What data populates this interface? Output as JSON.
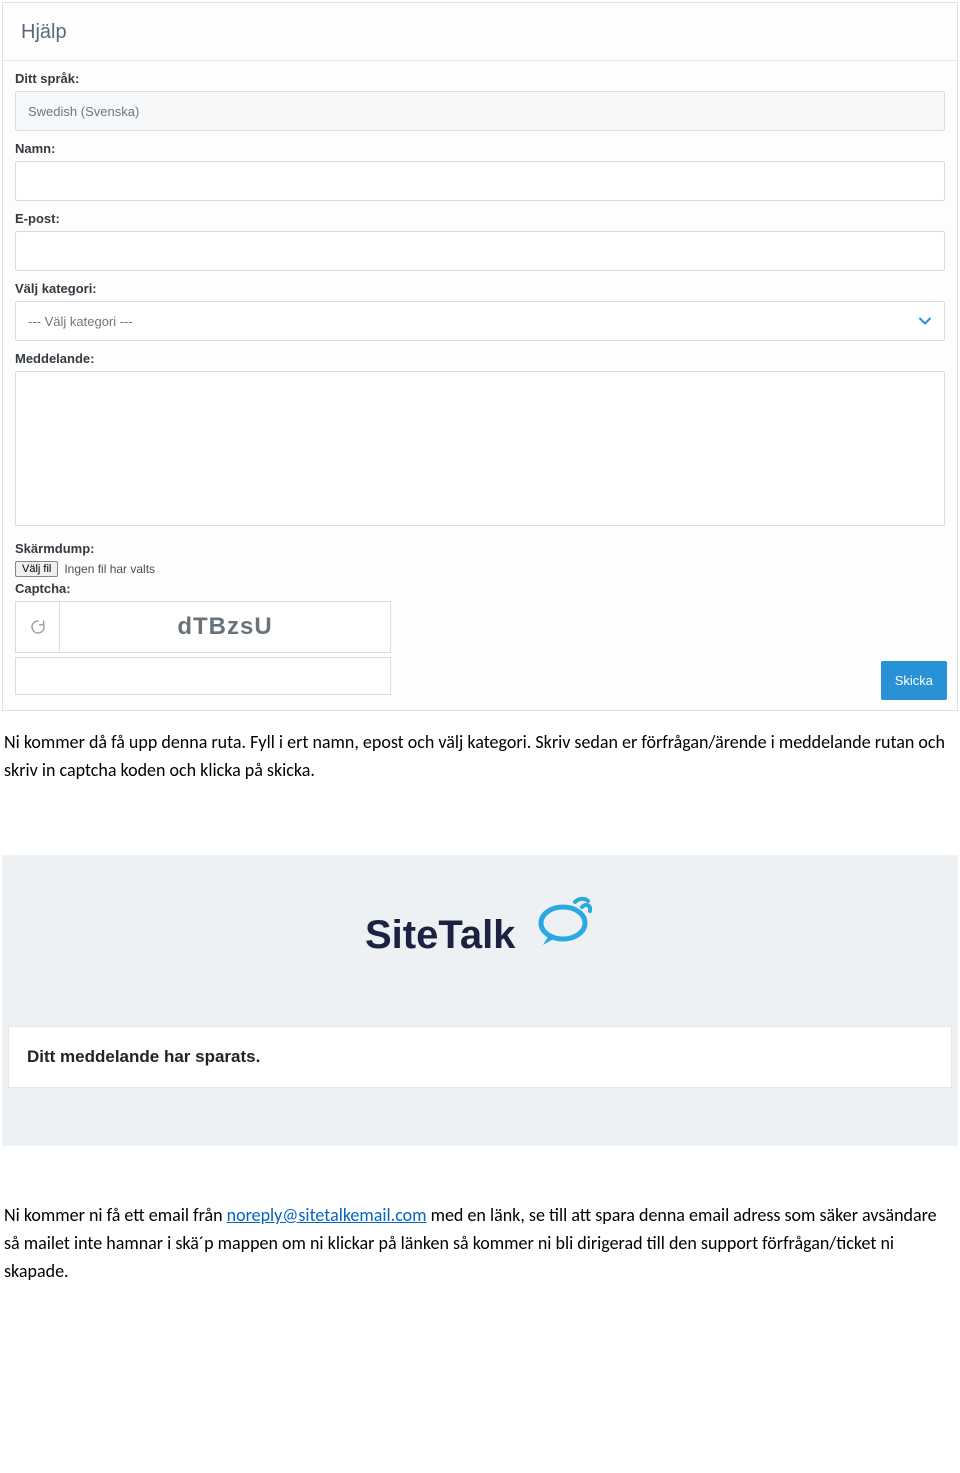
{
  "form": {
    "title": "Hjälp",
    "language_label": "Ditt språk:",
    "language_value": "Swedish (Svenska)",
    "name_label": "Namn:",
    "name_value": "",
    "email_label": "E-post:",
    "email_value": "",
    "category_label": "Välj kategori:",
    "category_value": "--- Välj kategori ---",
    "message_label": "Meddelande:",
    "message_value": "",
    "screenshot_label": "Skärmdump:",
    "file_button": "Välj fil",
    "file_status": "Ingen fil har valts",
    "captcha_label": "Captcha:",
    "captcha_value": "dTBzsU",
    "submit_label": "Skicka"
  },
  "instruction1": "Ni kommer då få upp denna ruta. Fyll i ert namn, epost och välj kategori. Skriv sedan er förfrågan/ärende i meddelande rutan och skriv in captcha koden och klicka på skicka.",
  "saved_message": "Ditt meddelande har sparats.",
  "instruction2_part1": "Ni kommer ni få ett email från ",
  "instruction2_link": "noreply@sitetalkemail.com",
  "instruction2_part2": " med en länk, se till att spara denna email adress som säker avsändare så mailet inte hamnar i skä´p mappen om ni klickar på länken så kommer ni bli dirigerad till den support förfrågan/ticket ni skapade.",
  "logo": {
    "text_site": "Site",
    "text_talk": "Talk"
  }
}
